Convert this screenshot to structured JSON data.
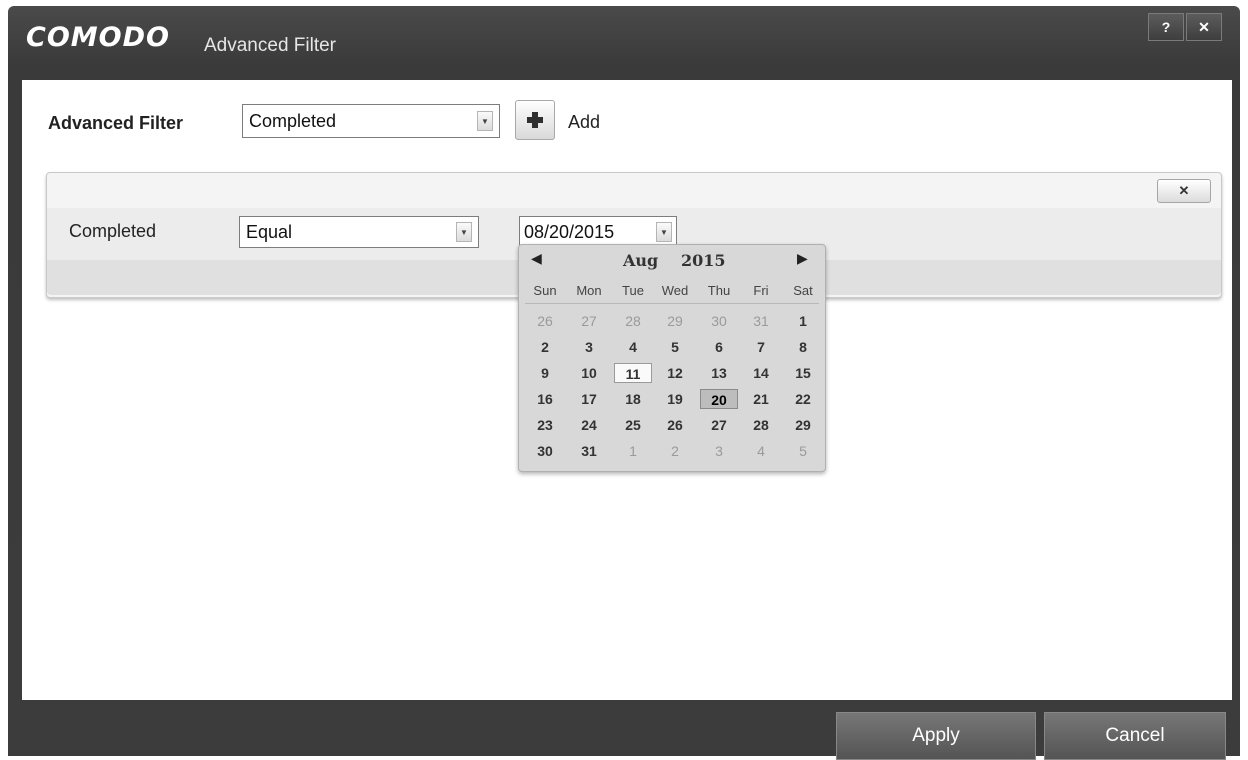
{
  "window": {
    "brand": "COMODO",
    "title": "Advanced Filter",
    "help_label": "?",
    "close_label": "✕"
  },
  "filter": {
    "label": "Advanced Filter",
    "selected": "Completed",
    "add_label": "Add"
  },
  "condition": {
    "close_label": "✕",
    "field": "Completed",
    "operator": "Equal",
    "date_value": "08/20/2015"
  },
  "calendar": {
    "prev_icon": "◀",
    "next_icon": "▶",
    "month": "Aug",
    "year": "2015",
    "weekdays": [
      "Sun",
      "Mon",
      "Tue",
      "Wed",
      "Thu",
      "Fri",
      "Sat"
    ],
    "weeks": [
      [
        "26",
        "27",
        "28",
        "29",
        "30",
        "31",
        "1"
      ],
      [
        "2",
        "3",
        "4",
        "5",
        "6",
        "7",
        "8"
      ],
      [
        "9",
        "10",
        "11",
        "12",
        "13",
        "14",
        "15"
      ],
      [
        "16",
        "17",
        "18",
        "19",
        "20",
        "21",
        "22"
      ],
      [
        "23",
        "24",
        "25",
        "26",
        "27",
        "28",
        "29"
      ],
      [
        "30",
        "31",
        "1",
        "2",
        "3",
        "4",
        "5"
      ]
    ],
    "today": "11",
    "selected": "20"
  },
  "footer": {
    "apply_label": "Apply",
    "cancel_label": "Cancel"
  },
  "colors": {
    "titlebar": "#3c3c3c",
    "calendar_bg": "#d8d8d8",
    "button_gray": "#666666"
  }
}
